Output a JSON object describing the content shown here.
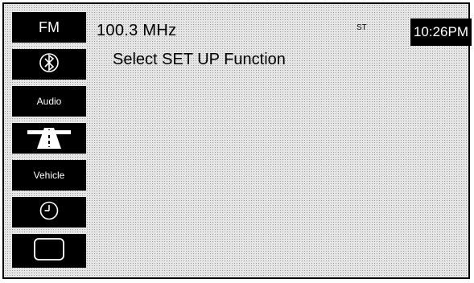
{
  "radio": {
    "band": "FM",
    "frequency": "100.3 MHz",
    "stereo_indicator": "ST",
    "time": "10:26PM"
  },
  "screen": {
    "prompt": "Select SET UP Function"
  },
  "sidebar": {
    "items": [
      {
        "label": "FM",
        "icon": null
      },
      {
        "label": "",
        "icon": "bluetooth-icon"
      },
      {
        "label": "Audio",
        "icon": null
      },
      {
        "label": "",
        "icon": "navigation-road-icon"
      },
      {
        "label": "Vehicle",
        "icon": null
      },
      {
        "label": "",
        "icon": "clock-icon"
      },
      {
        "label": "",
        "icon": "display-icon"
      }
    ]
  },
  "colors": {
    "button_bg": "#000000",
    "button_fg": "#ffffff",
    "screen_bg": "#e6e6e6"
  }
}
